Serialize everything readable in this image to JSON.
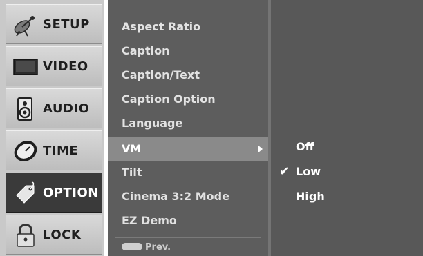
{
  "nav": {
    "items": [
      {
        "label": "SETUP",
        "icon": "satellite-dish-icon",
        "active": false
      },
      {
        "label": "VIDEO",
        "icon": "monitor-icon",
        "active": false
      },
      {
        "label": "AUDIO",
        "icon": "speaker-icon",
        "active": false
      },
      {
        "label": "TIME",
        "icon": "clock-icon",
        "active": false
      },
      {
        "label": "OPTION",
        "icon": "tag-icon",
        "active": true
      },
      {
        "label": "LOCK",
        "icon": "padlock-icon",
        "active": false
      }
    ]
  },
  "menu": {
    "items": [
      {
        "label": "Aspect Ratio",
        "highlight": false
      },
      {
        "label": "Caption",
        "highlight": false
      },
      {
        "label": "Caption/Text",
        "highlight": false
      },
      {
        "label": "Caption Option",
        "highlight": false
      },
      {
        "label": "Language",
        "highlight": false
      },
      {
        "label": "VM",
        "highlight": true,
        "has_submenu": true
      },
      {
        "label": "Tilt",
        "highlight": false
      },
      {
        "label": "Cinema 3:2 Mode",
        "highlight": false
      },
      {
        "label": "EZ Demo",
        "highlight": false
      }
    ],
    "prev_label": "Prev."
  },
  "submenu": {
    "items": [
      {
        "label": "Off",
        "checked": false
      },
      {
        "label": "Low",
        "checked": true
      },
      {
        "label": "High",
        "checked": false
      }
    ],
    "check_glyph": "✔"
  }
}
